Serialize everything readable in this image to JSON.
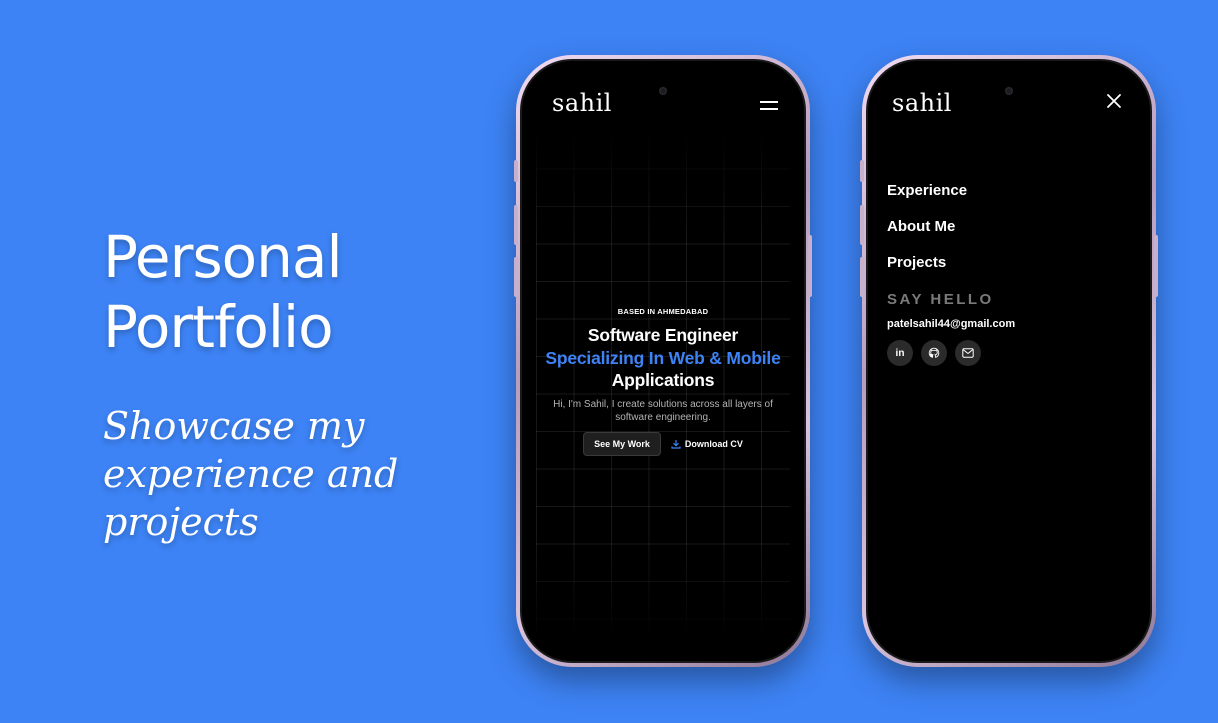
{
  "promo": {
    "title_line1": "Personal",
    "title_line2": "Portfolio",
    "subtitle": "Showcase my experience and projects"
  },
  "phone_home": {
    "logo": "sahil",
    "eyebrow": "BASED IN AHMEDABAD",
    "title_part1": "Software Engineer",
    "title_accent": "Specializing In Web & Mobile",
    "title_part2": "Applications",
    "description": "Hi, I'm Sahil, I create solutions across all layers of software engineering.",
    "primary_button": "See My Work",
    "secondary_button": "Download CV"
  },
  "phone_menu": {
    "logo": "sahil",
    "menu_items": [
      "Experience",
      "About Me",
      "Projects"
    ],
    "say_hello": "SAY HELLO",
    "email": "patelsahil44@gmail.com",
    "socials": {
      "linkedin_label": "in"
    }
  },
  "colors": {
    "background": "#3d83f5",
    "accent": "#3d83f5",
    "screen": "#000000"
  }
}
